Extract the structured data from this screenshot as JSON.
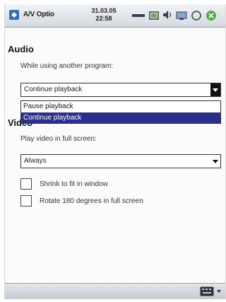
{
  "titlebar": {
    "app_title": "A/V Optio",
    "time_line1": "31.03.05",
    "time_line2": "22:58",
    "icons": [
      "start-icon",
      "signal-icon",
      "battery-icon",
      "volume-icon",
      "connectivity-icon",
      "ok-icon",
      "close-icon"
    ]
  },
  "audio": {
    "heading": "Audio",
    "prompt": "While using another program:",
    "selected": "Continue playback",
    "options": [
      "Pause playback",
      "Continue playback"
    ],
    "highlighted_option": "Continue playback"
  },
  "video": {
    "heading": "Video",
    "prompt": "Play video in full screen:",
    "selected": "Always",
    "checkboxes": [
      {
        "label": "Shrink to fit in window",
        "checked": false
      },
      {
        "label": "Rotate 180 degrees in full screen",
        "checked": false
      }
    ]
  },
  "bottombar": {
    "icons": [
      "keyboard-icon",
      "sip-arrow-icon"
    ]
  },
  "colors": {
    "highlight": "#2a2f8c",
    "titlebar": "#d4d9e1"
  }
}
